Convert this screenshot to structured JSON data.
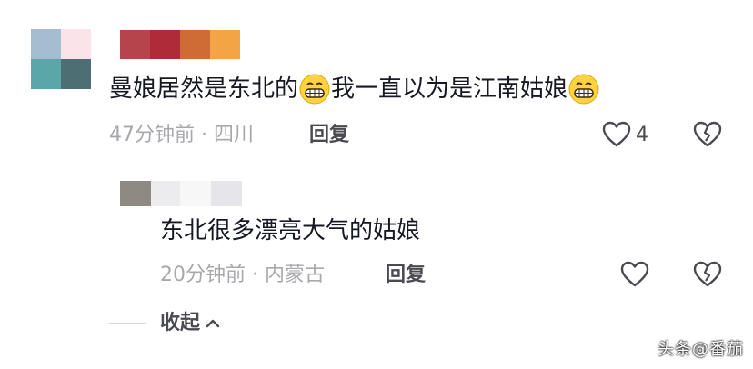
{
  "colors": {
    "text_primary": "#161823",
    "text_meta": "#a8a8ad",
    "text_action": "#4a4b52",
    "avatar1_tiles": [
      "#a5bcd1",
      "#fbe3ea",
      "#5aa6a8",
      "#4d6e73"
    ],
    "name1_tiles": [
      "#b5444d",
      "#b02b3a",
      "#cf6b35",
      "#f3a445"
    ],
    "name2_tiles": [
      "#ececee",
      "#f7f7f8",
      "#e6e6ea"
    ]
  },
  "comment_main": {
    "text_part1": "曼娘居然是东北的",
    "emoji1": "grinning-face",
    "text_part2": "我一直以为是江南姑娘",
    "emoji2": "grinning-face",
    "time_location": "47分钟前 · 四川",
    "reply_label": "回复",
    "like_count": "4"
  },
  "comment_reply": {
    "text": "东北很多漂亮大气的姑娘",
    "time_location": "20分钟前 · 内蒙古",
    "reply_label": "回复"
  },
  "collapse": {
    "label": "收起"
  },
  "watermark": {
    "text": "头条@番茄"
  }
}
